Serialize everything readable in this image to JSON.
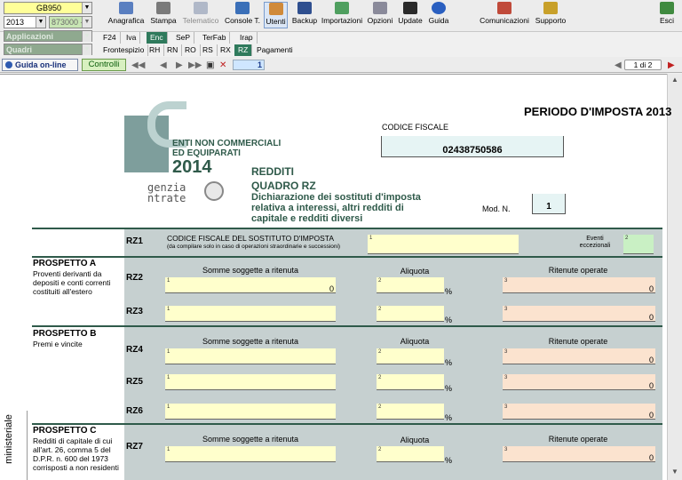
{
  "toolbar": {
    "company_code": "GB950",
    "year": "2013",
    "code_partial": "873000 -",
    "applicazioni": "Applicazioni",
    "quadri": "Quadri",
    "buttons": [
      {
        "label": "Anagrafica",
        "icon": "id-card-icon"
      },
      {
        "label": "Stampa",
        "icon": "printer-icon"
      },
      {
        "label": "Telematico",
        "icon": "telematico-icon"
      },
      {
        "label": "Console T.",
        "icon": "console-icon"
      },
      {
        "label": "Utenti",
        "icon": "users-icon"
      },
      {
        "label": "Backup",
        "icon": "backup-icon"
      },
      {
        "label": "Importazioni",
        "icon": "import-icon"
      },
      {
        "label": "Opzioni",
        "icon": "wrench-icon"
      },
      {
        "label": "Update",
        "icon": "update-icon"
      },
      {
        "label": "Guida",
        "icon": "help-icon"
      },
      {
        "label": "Comunicazioni",
        "icon": "communications-icon"
      },
      {
        "label": "Supporto",
        "icon": "support-icon"
      },
      {
        "label": "Esci",
        "icon": "exit-icon"
      }
    ]
  },
  "tabs_row1": [
    "F24",
    "Iva",
    "Enc",
    "SeP",
    "TerFab",
    "Irap"
  ],
  "tabs_row2": [
    "Frontespizio",
    "RH",
    "RN",
    "RO",
    "RS",
    "RX",
    "RZ",
    "Pagamenti"
  ],
  "nav": {
    "guida_label": "Guida on-line",
    "controlli_label": "Controlli",
    "page_current": "1",
    "page_of": "1 di 2"
  },
  "form": {
    "logo_line1": "ENTI NON COMMERCIALI",
    "logo_line2": "ED EQUIPARATI",
    "logo_year": "2014",
    "agenzia_line1": "genzia",
    "agenzia_line2": "ntrate",
    "periodo": "PERIODO D'IMPOSTA 2013",
    "cf_label": "CODICE FISCALE",
    "cf_value": "02438750586",
    "redditi": "REDDITI",
    "quadro": "QUADRO RZ",
    "quadro_desc": "Dichiarazione dei sostituti d'imposta relativa a interessi, altri redditi di capitale e redditi diversi",
    "modn_label": "Mod. N.",
    "modn_value": "1",
    "rz1": {
      "code": "RZ1",
      "title": "CODICE FISCALE DEL SOSTITUTO D'IMPOSTA",
      "note": "(da compilare solo in caso di operazioni straordinarie e successioni)",
      "eventi": "Eventi eccezionali",
      "field1_num": "1",
      "field2_num": "2"
    },
    "col_somme": "Somme soggette a ritenuta",
    "col_aliquota": "Aliquota",
    "col_ritenute": "Ritenute operate",
    "pct": "%",
    "zero": "0",
    "n1": "1",
    "n2": "2",
    "n3": "3",
    "prospetti": [
      {
        "title": "PROSPETTO A",
        "desc": "Proventi derivanti da depositi e conti correnti costituiti all'estero"
      },
      {
        "title": "PROSPETTO B",
        "desc": "Premi e vincite"
      },
      {
        "title": "PROSPETTO C",
        "desc": "Redditi di capitale di cui all'art. 26, comma 5 del D.P.R. n. 600 del 1973 corrisposti a non residenti"
      }
    ],
    "rows": [
      "RZ2",
      "RZ3",
      "RZ4",
      "RZ5",
      "RZ6",
      "RZ7"
    ],
    "side_label": "ministeriale"
  }
}
